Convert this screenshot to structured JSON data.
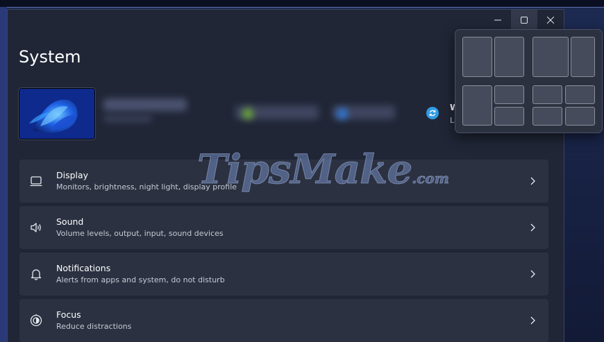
{
  "window": {
    "title": "System"
  },
  "caption": {
    "minimize_icon": "minimize-icon",
    "maximize_icon": "maximize-icon",
    "close_icon": "close-icon"
  },
  "update": {
    "title": "W",
    "subtitle": "La"
  },
  "settings": [
    {
      "icon": "display-icon",
      "title": "Display",
      "subtitle": "Monitors, brightness, night light, display profile"
    },
    {
      "icon": "speaker-icon",
      "title": "Sound",
      "subtitle": "Volume levels, output, input, sound devices"
    },
    {
      "icon": "bell-icon",
      "title": "Notifications",
      "subtitle": "Alerts from apps and system, do not disturb"
    },
    {
      "icon": "focus-icon",
      "title": "Focus",
      "subtitle": "Reduce distractions"
    }
  ],
  "watermark": {
    "main": "TipsMake",
    "suffix": ".com"
  }
}
